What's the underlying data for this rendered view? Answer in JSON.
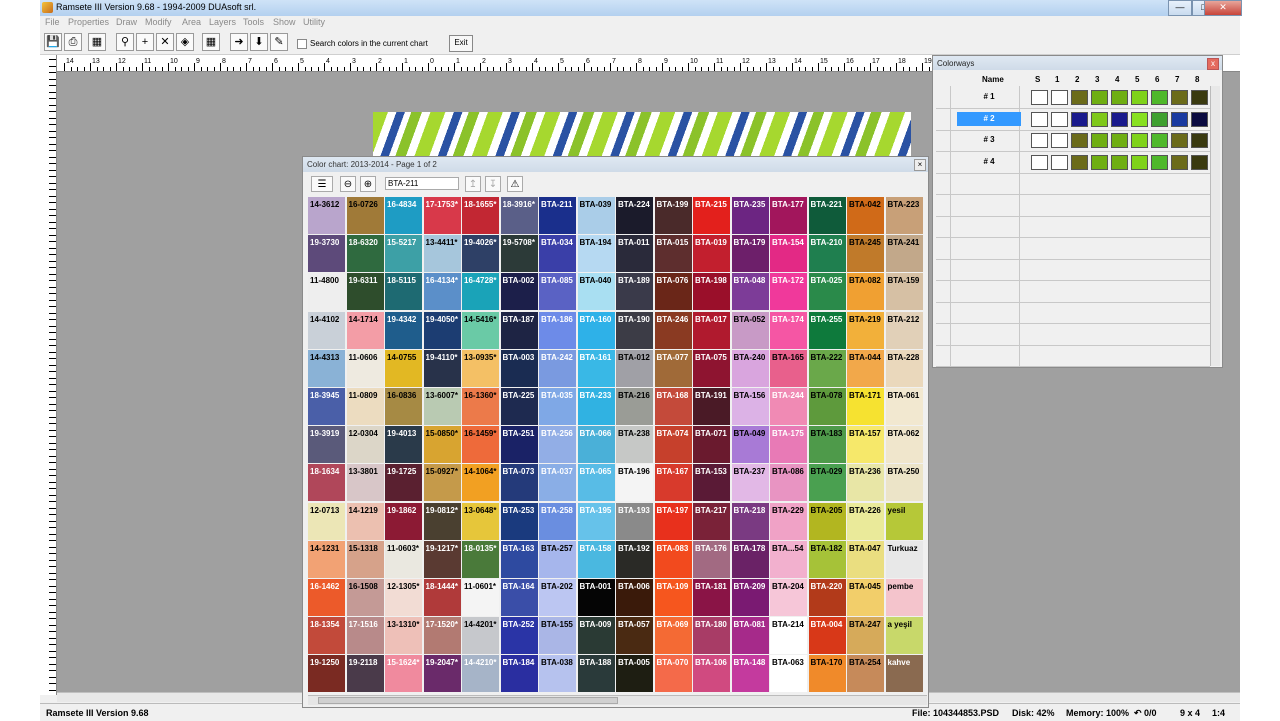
{
  "window": {
    "title": "Ramsete III  Version 9.68 - 1994-2009 DUAsoft srl.",
    "min_label": "—",
    "max_label": "□",
    "close_label": "✕"
  },
  "menu": [
    "File",
    "Properties",
    "Draw",
    "Modify",
    "Area",
    "Layers",
    "Tools",
    "Show",
    "Utility"
  ],
  "toolbar": {
    "search_label": "Search colors in the current chart",
    "exit_label": "Exit",
    "icons": [
      "save-icon",
      "print-icon",
      "calculator-icon",
      "find-icon",
      "plus-icon",
      "cross-icon",
      "paint-bucket-icon",
      "grid-icon",
      "arrow-right-icon",
      "arrow-down-icon",
      "brush-icon"
    ]
  },
  "ruler": {
    "top_labels": [
      "14",
      "13",
      "12",
      "11",
      "10",
      "9",
      "8",
      "7",
      "6",
      "5",
      "4",
      "3",
      "2",
      "1",
      "0",
      "1",
      "2",
      "3",
      "4",
      "5",
      "6",
      "7",
      "8",
      "9",
      "10",
      "11",
      "12",
      "13",
      "14",
      "15",
      "16",
      "17",
      "18",
      "19",
      "20",
      "21",
      "22",
      "23",
      "24",
      "25",
      "26",
      "27",
      "28",
      "29"
    ]
  },
  "color_chart": {
    "title": "Color chart: 2013-2014 - Page 1 of 2",
    "search_value": "BTA-211",
    "rows": [
      [
        [
          "14-3612",
          "#b9a5cc",
          "#000"
        ],
        [
          "16-0726",
          "#a07a38",
          "#000"
        ],
        [
          "16-4834",
          "#1e9cc4",
          "#fff"
        ],
        [
          "17-1753*",
          "#d8394a",
          "#fff"
        ],
        [
          "18-1655*",
          "#c22733",
          "#fff"
        ],
        [
          "18-3916*",
          "#5a5f88",
          "#fff"
        ],
        [
          "BTA-211",
          "#1a2f8c",
          "#fff"
        ],
        [
          "BTA-039",
          "#aacde8",
          "#000"
        ],
        [
          "BTA-224",
          "#1b1b2b",
          "#fff"
        ],
        [
          "BTA-199",
          "#4a2a2a",
          "#fff"
        ],
        [
          "BTA-215",
          "#e3201c",
          "#fff"
        ],
        [
          "BTA-235",
          "#6c2582",
          "#fff"
        ],
        [
          "BTA-177",
          "#a2165c",
          "#fff"
        ],
        [
          "BTA-221",
          "#0f5b3a",
          "#fff"
        ],
        [
          "BTA-042",
          "#d06a18",
          "#000"
        ],
        [
          "BTA-223",
          "#c8a078",
          "#000"
        ]
      ],
      [
        [
          "19-3730",
          "#5d4a7a",
          "#fff"
        ],
        [
          "18-6320",
          "#2f6a3f",
          "#fff"
        ],
        [
          "15-5217",
          "#3da0a6",
          "#fff"
        ],
        [
          "13-4411*",
          "#a6c6dc",
          "#000"
        ],
        [
          "19-4026*",
          "#2e4066",
          "#fff"
        ],
        [
          "19-5708*",
          "#2c3a38",
          "#fff"
        ],
        [
          "BTA-034",
          "#3a3fa8",
          "#fff"
        ],
        [
          "BTA-194",
          "#b6d9f2",
          "#000"
        ],
        [
          "BTA-011",
          "#2a2a3a",
          "#fff"
        ],
        [
          "BTA-015",
          "#5e2e2e",
          "#fff"
        ],
        [
          "BTA-019",
          "#c21f2e",
          "#fff"
        ],
        [
          "BTA-179",
          "#6d1f6a",
          "#fff"
        ],
        [
          "BTA-154",
          "#e32985",
          "#fff"
        ],
        [
          "BTA-210",
          "#1f7f4f",
          "#fff"
        ],
        [
          "BTA-245",
          "#c07a2a",
          "#000"
        ],
        [
          "BTA-241",
          "#c2a88a",
          "#000"
        ]
      ],
      [
        [
          "11-4800",
          "#eeeeee",
          "#000"
        ],
        [
          "19-6311",
          "#2e4d2c",
          "#fff"
        ],
        [
          "18-5115",
          "#1e6a72",
          "#fff"
        ],
        [
          "16-4134*",
          "#5b8fc9",
          "#fff"
        ],
        [
          "16-4728*",
          "#1aa3b8",
          "#fff"
        ],
        [
          "BTA-002",
          "#1c1f4a",
          "#fff"
        ],
        [
          "BTA-085",
          "#5a62c4",
          "#fff"
        ],
        [
          "BTA-040",
          "#a9dff2",
          "#000"
        ],
        [
          "BTA-189",
          "#3a3a4a",
          "#fff"
        ],
        [
          "BTA-076",
          "#6a2618",
          "#fff"
        ],
        [
          "BTA-198",
          "#9a0f2a",
          "#fff"
        ],
        [
          "BTA-048",
          "#7d3c98",
          "#fff"
        ],
        [
          "BTA-172",
          "#f0399b",
          "#fff"
        ],
        [
          "BTA-025",
          "#2a8a4a",
          "#fff"
        ],
        [
          "BTA-082",
          "#f0a032",
          "#000"
        ],
        [
          "BTA-159",
          "#d6c0a4",
          "#000"
        ]
      ],
      [
        [
          "14-4102",
          "#c9d0d8",
          "#000"
        ],
        [
          "14-1714",
          "#f39da6",
          "#000"
        ],
        [
          "19-4342",
          "#1f5d8c",
          "#fff"
        ],
        [
          "19-4050*",
          "#1c3d72",
          "#fff"
        ],
        [
          "14-5416*",
          "#6acaa6",
          "#000"
        ],
        [
          "BTA-187",
          "#1e2444",
          "#fff"
        ],
        [
          "BTA-186",
          "#6d8be8",
          "#fff"
        ],
        [
          "BTA-160",
          "#2eb1e8",
          "#fff"
        ],
        [
          "BTA-190",
          "#3c3c46",
          "#fff"
        ],
        [
          "BTA-246",
          "#8a3a22",
          "#fff"
        ],
        [
          "BTA-017",
          "#b01a2e",
          "#fff"
        ],
        [
          "BTA-052",
          "#c89ac6",
          "#000"
        ],
        [
          "BTA-174",
          "#f556a4",
          "#fff"
        ],
        [
          "BTA-255",
          "#0e7a3c",
          "#fff"
        ],
        [
          "BTA-219",
          "#f2b03a",
          "#000"
        ],
        [
          "BTA-212",
          "#e1d0b8",
          "#000"
        ]
      ],
      [
        [
          "14-4313",
          "#8ab2d6",
          "#000"
        ],
        [
          "11-0606",
          "#eeeae0",
          "#000"
        ],
        [
          "14-0755",
          "#e2b823",
          "#000"
        ],
        [
          "19-4110*",
          "#28324a",
          "#fff"
        ],
        [
          "13-0935*",
          "#f4c065",
          "#000"
        ],
        [
          "BTA-003",
          "#1a2c52",
          "#fff"
        ],
        [
          "BTA-242",
          "#7a9ae0",
          "#fff"
        ],
        [
          "BTA-161",
          "#39b8e6",
          "#fff"
        ],
        [
          "BTA-012",
          "#a0a0a6",
          "#000"
        ],
        [
          "BTA-077",
          "#a06a38",
          "#fff"
        ],
        [
          "BTA-075",
          "#8e1430",
          "#fff"
        ],
        [
          "BTA-240",
          "#d9a5de",
          "#000"
        ],
        [
          "BTA-165",
          "#e8608c",
          "#000"
        ],
        [
          "BTA-222",
          "#6aa84a",
          "#000"
        ],
        [
          "BTA-044",
          "#f2a84a",
          "#000"
        ],
        [
          "BTA-228",
          "#ead8bc",
          "#000"
        ]
      ],
      [
        [
          "18-3945",
          "#4a5fa8",
          "#fff"
        ],
        [
          "11-0809",
          "#ecdcc0",
          "#000"
        ],
        [
          "16-0836",
          "#a68a44",
          "#000"
        ],
        [
          "13-6007*",
          "#b9cab2",
          "#000"
        ],
        [
          "16-1360*",
          "#ec7a4a",
          "#000"
        ],
        [
          "BTA-225",
          "#1e2a50",
          "#fff"
        ],
        [
          "BTA-035",
          "#7fa8e6",
          "#fff"
        ],
        [
          "BTA-233",
          "#30b2e2",
          "#fff"
        ],
        [
          "BTA-216",
          "#9a9c96",
          "#000"
        ],
        [
          "BTA-168",
          "#c44a3a",
          "#fff"
        ],
        [
          "BTA-191",
          "#4a1a26",
          "#fff"
        ],
        [
          "BTA-156",
          "#dcb2e6",
          "#000"
        ],
        [
          "BTA-244",
          "#f08ab4",
          "#fff"
        ],
        [
          "BTA-078",
          "#5e9a3c",
          "#000"
        ],
        [
          "BTA-171",
          "#f6e230",
          "#000"
        ],
        [
          "BTA-061",
          "#f2e8d0",
          "#000"
        ]
      ],
      [
        [
          "19-3919",
          "#5a5a7a",
          "#fff"
        ],
        [
          "12-0304",
          "#dcd6c8",
          "#000"
        ],
        [
          "19-4013",
          "#2a3a4a",
          "#fff"
        ],
        [
          "15-0850*",
          "#d8a430",
          "#000"
        ],
        [
          "16-1459*",
          "#ee6a3a",
          "#000"
        ],
        [
          "BTA-251",
          "#1a2266",
          "#fff"
        ],
        [
          "BTA-256",
          "#92aee6",
          "#fff"
        ],
        [
          "BTA-066",
          "#4ab0d8",
          "#fff"
        ],
        [
          "BTA-238",
          "#c6c8c6",
          "#000"
        ],
        [
          "BTA-074",
          "#c6402c",
          "#fff"
        ],
        [
          "BTA-071",
          "#6a1a2e",
          "#fff"
        ],
        [
          "BTA-049",
          "#a87ad6",
          "#000"
        ],
        [
          "BTA-175",
          "#e87ab6",
          "#fff"
        ],
        [
          "BTA-183",
          "#4e9a4a",
          "#000"
        ],
        [
          "BTA-157",
          "#f6e86a",
          "#000"
        ],
        [
          "BTA-062",
          "#f0e6cc",
          "#000"
        ]
      ],
      [
        [
          "18-1634",
          "#b0475a",
          "#fff"
        ],
        [
          "13-3801",
          "#d8c6c8",
          "#000"
        ],
        [
          "19-1725",
          "#5a2030",
          "#fff"
        ],
        [
          "15-0927*",
          "#c59a4a",
          "#000"
        ],
        [
          "14-1064*",
          "#f2a022",
          "#000"
        ],
        [
          "BTA-073",
          "#243a7a",
          "#fff"
        ],
        [
          "BTA-037",
          "#8aaee6",
          "#fff"
        ],
        [
          "BTA-065",
          "#58bce6",
          "#fff"
        ],
        [
          "BTA-196",
          "#f4f4f4",
          "#000"
        ],
        [
          "BTA-167",
          "#d83a2c",
          "#fff"
        ],
        [
          "BTA-153",
          "#5a1a36",
          "#fff"
        ],
        [
          "BTA-237",
          "#e2b8e6",
          "#000"
        ],
        [
          "BTA-086",
          "#e894c2",
          "#000"
        ],
        [
          "BTA-029",
          "#4aa050",
          "#000"
        ],
        [
          "BTA-236",
          "#e8e6a6",
          "#000"
        ],
        [
          "BTA-250",
          "#ece4c8",
          "#000"
        ]
      ],
      [
        [
          "12-0713",
          "#ece6b6",
          "#000"
        ],
        [
          "14-1219",
          "#ecc0b0",
          "#000"
        ],
        [
          "19-1862",
          "#8c1a34",
          "#fff"
        ],
        [
          "19-0812*",
          "#4a4030",
          "#fff"
        ],
        [
          "13-0648*",
          "#e6c63a",
          "#000"
        ],
        [
          "BTA-253",
          "#1a3a7e",
          "#fff"
        ],
        [
          "BTA-258",
          "#6a8ee0",
          "#fff"
        ],
        [
          "BTA-195",
          "#66c2ea",
          "#fff"
        ],
        [
          "BTA-193",
          "#8a8a8a",
          "#fff"
        ],
        [
          "BTA-197",
          "#e8301c",
          "#fff"
        ],
        [
          "BTA-217",
          "#7a2238",
          "#fff"
        ],
        [
          "BTA-218",
          "#7a3a82",
          "#fff"
        ],
        [
          "BTA-229",
          "#f0a2c6",
          "#000"
        ],
        [
          "BTA-205",
          "#b2b620",
          "#000"
        ],
        [
          "BTA-226",
          "#eaea9a",
          "#000"
        ],
        [
          "yesil",
          "#b6c838",
          "#000"
        ]
      ],
      [
        [
          "14-1231",
          "#f2a274",
          "#000"
        ],
        [
          "15-1318",
          "#d6a28a",
          "#000"
        ],
        [
          "11-0603*",
          "#eae8e0",
          "#000"
        ],
        [
          "19-1217*",
          "#5a3a32",
          "#fff"
        ],
        [
          "18-0135*",
          "#4a7a3a",
          "#fff"
        ],
        [
          "BTA-163",
          "#2e4aa0",
          "#fff"
        ],
        [
          "BTA-257",
          "#a6b6ec",
          "#000"
        ],
        [
          "BTA-158",
          "#4ab8e0",
          "#fff"
        ],
        [
          "BTA-192",
          "#2a2a26",
          "#fff"
        ],
        [
          "BTA-083",
          "#f24a1e",
          "#fff"
        ],
        [
          "BTA-176",
          "#a26a82",
          "#fff"
        ],
        [
          "BTA-178",
          "#6a2266",
          "#fff"
        ],
        [
          "BTA...54",
          "#f2b0ce",
          "#000"
        ],
        [
          "BTA-182",
          "#a6c238",
          "#000"
        ],
        [
          "BTA-047",
          "#eade80",
          "#000"
        ],
        [
          "Turkuaz",
          "#e8e8e8",
          "#000"
        ]
      ],
      [
        [
          "16-1462",
          "#ec5a2a",
          "#fff"
        ],
        [
          "16-1508",
          "#c49a96",
          "#000"
        ],
        [
          "12-1305*",
          "#f2dcd4",
          "#000"
        ],
        [
          "18-1444*",
          "#b03a3a",
          "#fff"
        ],
        [
          "11-0601*",
          "#f4f4f4",
          "#000"
        ],
        [
          "BTA-164",
          "#3a4ea8",
          "#fff"
        ],
        [
          "BTA-202",
          "#bcc6f2",
          "#000"
        ],
        [
          "BTA-001",
          "#050505",
          "#fff"
        ],
        [
          "BTA-006",
          "#3a1a0a",
          "#fff"
        ],
        [
          "BTA-109",
          "#f6561e",
          "#fff"
        ],
        [
          "BTA-181",
          "#8a1446",
          "#fff"
        ],
        [
          "BTA-209",
          "#7a1a72",
          "#fff"
        ],
        [
          "BTA-204",
          "#f6c6d8",
          "#000"
        ],
        [
          "BTA-220",
          "#b23a1a",
          "#fff"
        ],
        [
          "BTA-045",
          "#f2ce6a",
          "#000"
        ],
        [
          "pembe",
          "#f4c4cc",
          "#000"
        ]
      ],
      [
        [
          "18-1354",
          "#c24a3a",
          "#fff"
        ],
        [
          "17-1516",
          "#b88a8a",
          "#fff"
        ],
        [
          "13-1310*",
          "#eec0b8",
          "#000"
        ],
        [
          "17-1520*",
          "#b27a72",
          "#fff"
        ],
        [
          "14-4201*",
          "#c6c8cc",
          "#000"
        ],
        [
          "BTA-252",
          "#2a34a6",
          "#fff"
        ],
        [
          "BTA-155",
          "#aab6e6",
          "#000"
        ],
        [
          "BTA-009",
          "#2a3a34",
          "#fff"
        ],
        [
          "BTA-057",
          "#4a2a12",
          "#fff"
        ],
        [
          "BTA-069",
          "#f46a34",
          "#fff"
        ],
        [
          "BTA-180",
          "#a83c66",
          "#fff"
        ],
        [
          "BTA-081",
          "#a62a8a",
          "#fff"
        ],
        [
          "BTA-214",
          "#ffffff",
          "#000"
        ],
        [
          "BTA-004",
          "#d83818",
          "#fff"
        ],
        [
          "BTA-247",
          "#d6aa5a",
          "#000"
        ],
        [
          "a yeşil",
          "#c8d86a",
          "#000"
        ]
      ],
      [
        [
          "19-1250",
          "#7a2a22",
          "#fff"
        ],
        [
          "19-2118",
          "#4a3a4a",
          "#fff"
        ],
        [
          "15-1624*",
          "#f08a9e",
          "#fff"
        ],
        [
          "19-2047*",
          "#6a2a6a",
          "#fff"
        ],
        [
          "14-4210*",
          "#a6b4c8",
          "#fff"
        ],
        [
          "BTA-184",
          "#2a2ea0",
          "#fff"
        ],
        [
          "BTA-038",
          "#b6c2ee",
          "#000"
        ],
        [
          "BTA-188",
          "#2a3a3a",
          "#fff"
        ],
        [
          "BTA-005",
          "#1e1e12",
          "#fff"
        ],
        [
          "BTA-070",
          "#f46a4a",
          "#fff"
        ],
        [
          "BTA-106",
          "#d04a80",
          "#fff"
        ],
        [
          "BTA-148",
          "#c43a9e",
          "#fff"
        ],
        [
          "BTA-063",
          "#ffffff",
          "#000"
        ],
        [
          "BTA-170",
          "#f08a2a",
          "#000"
        ],
        [
          "BTA-254",
          "#c68a5a",
          "#000"
        ],
        [
          "kahve",
          "#8a6a50",
          "#fff"
        ]
      ]
    ]
  },
  "colorways": {
    "title": "Colorways",
    "close_label": "x",
    "headers": {
      "name": "Name",
      "cols": [
        "S",
        "1",
        "2",
        "3",
        "4",
        "5",
        "6",
        "7",
        "8"
      ]
    },
    "rows": [
      {
        "name": "# 1",
        "selected": false,
        "cells": [
          "#ffffff",
          "#ffffff",
          "#6b6b1a",
          "#6fae12",
          "#6fae12",
          "#7fd21a",
          "#4fb82a",
          "#6b6b1a",
          "#3a3a10"
        ]
      },
      {
        "name": "# 2",
        "selected": true,
        "cells": [
          "#ffffff",
          "#ffffff",
          "#1a1a8c",
          "#7fc81a",
          "#1a1a8c",
          "#88e020",
          "#3fa030",
          "#1a3aa0",
          "#0a0a40"
        ]
      },
      {
        "name": "# 3",
        "selected": false,
        "cells": [
          "#ffffff",
          "#ffffff",
          "#6b6b1a",
          "#6fae12",
          "#6fae12",
          "#7fd21a",
          "#4fb82a",
          "#6b6b1a",
          "#3a3a10"
        ]
      },
      {
        "name": "# 4",
        "selected": false,
        "cells": [
          "#ffffff",
          "#ffffff",
          "#6b6b1a",
          "#6fae12",
          "#6fae12",
          "#7fd21a",
          "#4fb82a",
          "#6b6b1a",
          "#3a3a10"
        ]
      }
    ]
  },
  "status": {
    "left": "Ramsete III Version 9.68",
    "file": "File: 104344853.PSD",
    "disk": "Disk: 42%",
    "memory": "Memory: 100%",
    "undo": "↶ 0/0",
    "grid": "9 x 4",
    "zoom": "1:4"
  }
}
